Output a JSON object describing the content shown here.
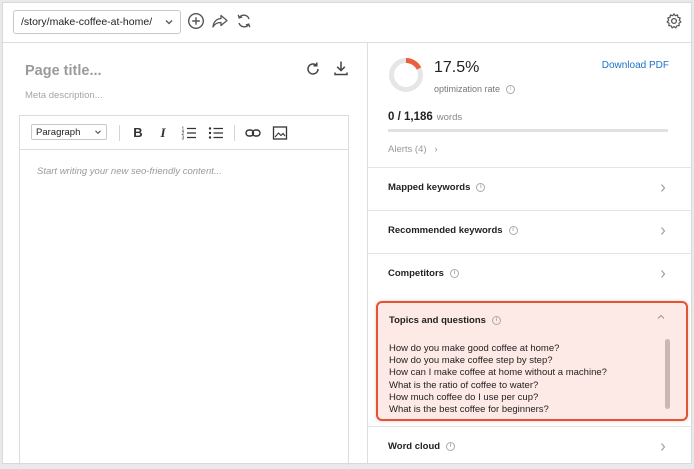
{
  "toolbar": {
    "url_path": "/story/make-coffee-at-home/",
    "add_icon": "add-circle-icon",
    "share_icon": "share-icon",
    "sync_icon": "sync-icon",
    "settings_icon": "gear-icon"
  },
  "editor": {
    "page_title_placeholder": "Page title...",
    "meta_description_placeholder": "Meta description...",
    "paragraph_style": "Paragraph",
    "content_placeholder": "Start writing your new seo-friendly content...",
    "format_buttons": [
      "bold",
      "italic",
      "ordered-list",
      "bulleted-list",
      "link",
      "image"
    ]
  },
  "stats": {
    "optimization_rate": "17.5%",
    "optimization_label": "optimization rate",
    "optimization_fraction": 0.175,
    "download_label": "Download PDF",
    "word_count": "0 / 1,186",
    "words_label": "words",
    "alerts_label": "Alerts (4)"
  },
  "sections": {
    "mapped_keywords": "Mapped keywords",
    "recommended_keywords": "Recommended keywords",
    "competitors": "Competitors",
    "topics_and_questions": "Topics and questions",
    "word_cloud": "Word cloud"
  },
  "topics": [
    "How do you make good coffee at home?",
    "How do you make coffee step by step?",
    "How can I make coffee at home without a machine?",
    "What is the ratio of coffee to water?",
    "How much coffee do I use per cup?",
    "What is the best coffee for beginners?"
  ],
  "colors": {
    "accent": "#e05535",
    "ring_track": "#e6e6e6",
    "ring_fill": "#e8613c",
    "link": "#1a73c8",
    "highlight_bg": "#fde9e5"
  }
}
